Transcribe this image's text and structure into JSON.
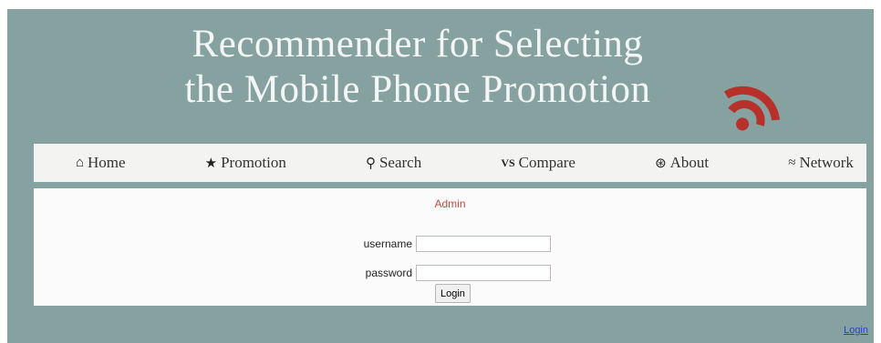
{
  "header": {
    "title_line1": "Recommender for Selecting",
    "title_line2": "the Mobile Phone Promotion",
    "logo_icon": "rss-feed-icon",
    "logo_color": "#c0392b"
  },
  "nav": {
    "items": [
      {
        "icon": "home-icon",
        "glyph": "⌂",
        "label": "Home"
      },
      {
        "icon": "star-icon",
        "glyph": "★",
        "label": "Promotion"
      },
      {
        "icon": "search-icon",
        "glyph": "⚲",
        "label": "Search"
      },
      {
        "icon": "versus-icon",
        "glyph": "VS",
        "label": "Compare"
      },
      {
        "icon": "binoculars-icon",
        "glyph": "⊛",
        "label": "About"
      },
      {
        "icon": "rss-icon",
        "glyph": "≈",
        "label": "Network"
      }
    ]
  },
  "login_form": {
    "heading": "Admin",
    "username_label": "username",
    "username_value": "",
    "password_label": "password",
    "password_value": "",
    "submit_label": "Login"
  },
  "footer": {
    "link_label": "Login"
  },
  "colors": {
    "background": "#86a2a0",
    "heading_accent": "#c44a3e"
  }
}
